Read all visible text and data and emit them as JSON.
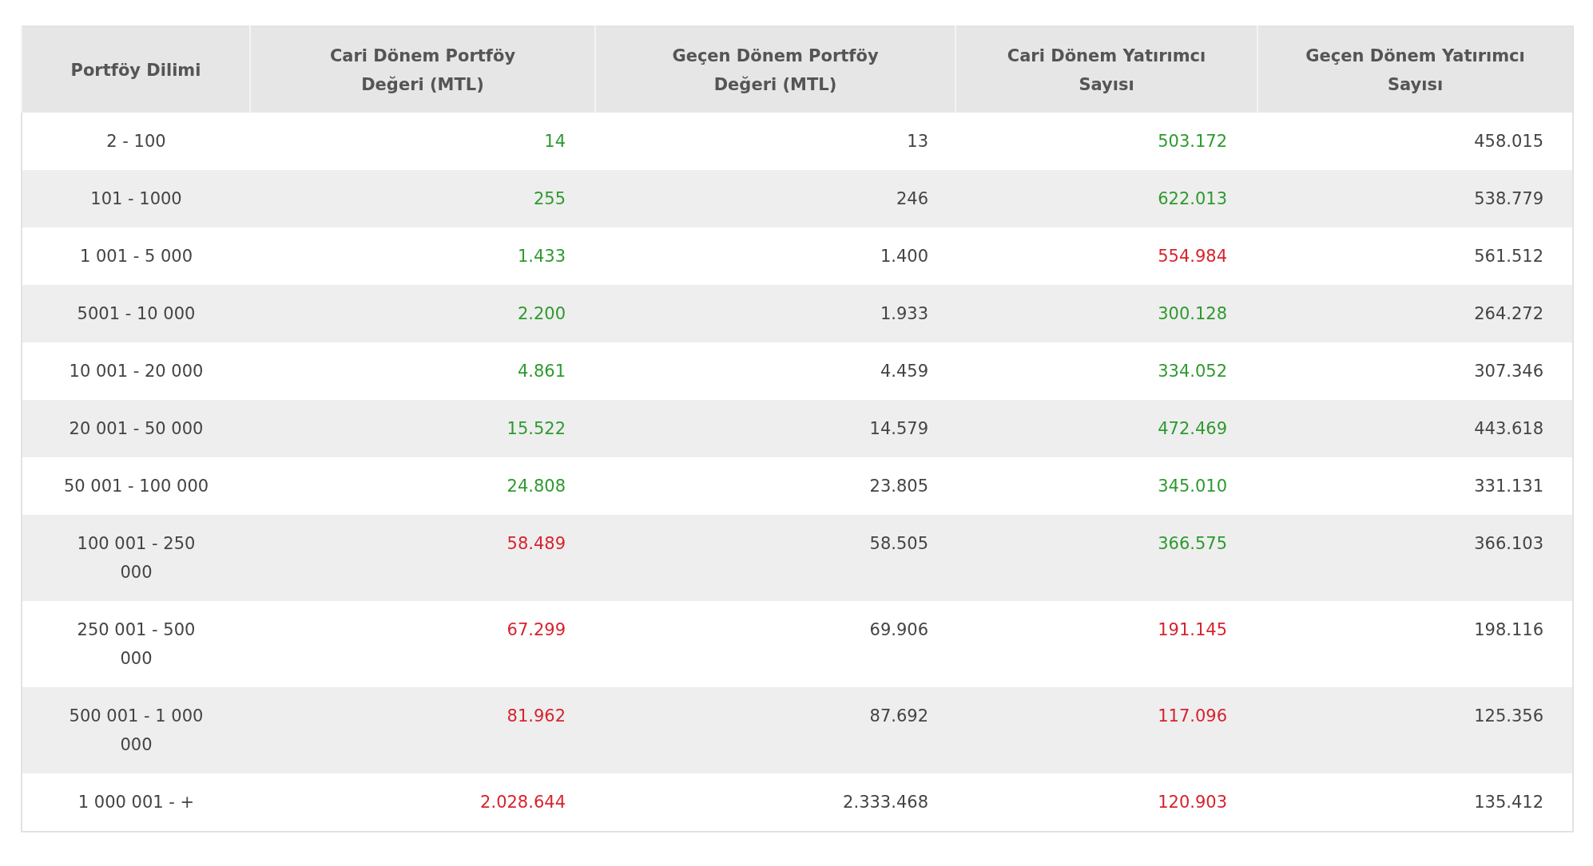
{
  "table": {
    "columns": [
      "Portföy Dilimi",
      "Cari Dönem Portföy Değeri (MTL)",
      "Geçen Dönem Portföy Değeri (MTL)",
      "Cari Dönem Yatırımcı Sayısı",
      "Geçen Dönem Yatırımcı Sayısı"
    ],
    "rows": [
      {
        "slice": "2 - 100",
        "current_value": {
          "text": "14",
          "color": "#2e9a2e"
        },
        "previous_value": "13",
        "current_investors": {
          "text": "503.172",
          "color": "#2e9a2e"
        },
        "previous_investors": "458.015"
      },
      {
        "slice": "101 - 1000",
        "current_value": {
          "text": "255",
          "color": "#2e9a2e"
        },
        "previous_value": "246",
        "current_investors": {
          "text": "622.013",
          "color": "#2e9a2e"
        },
        "previous_investors": "538.779"
      },
      {
        "slice": "1 001 - 5 000",
        "current_value": {
          "text": "1.433",
          "color": "#2e9a2e"
        },
        "previous_value": "1.400",
        "current_investors": {
          "text": "554.984",
          "color": "#d8232d"
        },
        "previous_investors": "561.512"
      },
      {
        "slice": "5001 - 10 000",
        "current_value": {
          "text": "2.200",
          "color": "#2e9a2e"
        },
        "previous_value": "1.933",
        "current_investors": {
          "text": "300.128",
          "color": "#2e9a2e"
        },
        "previous_investors": "264.272"
      },
      {
        "slice": "10 001 - 20 000",
        "current_value": {
          "text": "4.861",
          "color": "#2e9a2e"
        },
        "previous_value": "4.459",
        "current_investors": {
          "text": "334.052",
          "color": "#2e9a2e"
        },
        "previous_investors": "307.346"
      },
      {
        "slice": "20 001 - 50 000",
        "current_value": {
          "text": "15.522",
          "color": "#2e9a2e"
        },
        "previous_value": "14.579",
        "current_investors": {
          "text": "472.469",
          "color": "#2e9a2e"
        },
        "previous_investors": "443.618"
      },
      {
        "slice": "50 001 - 100 000",
        "current_value": {
          "text": "24.808",
          "color": "#2e9a2e"
        },
        "previous_value": "23.805",
        "current_investors": {
          "text": "345.010",
          "color": "#2e9a2e"
        },
        "previous_investors": "331.131"
      },
      {
        "slice": "100 001 - 250 000",
        "current_value": {
          "text": "58.489",
          "color": "#d8232d"
        },
        "previous_value": "58.505",
        "current_investors": {
          "text": "366.575",
          "color": "#2e9a2e"
        },
        "previous_investors": "366.103"
      },
      {
        "slice": "250 001 - 500 000",
        "current_value": {
          "text": "67.299",
          "color": "#d8232d"
        },
        "previous_value": "69.906",
        "current_investors": {
          "text": "191.145",
          "color": "#d8232d"
        },
        "previous_investors": "198.116"
      },
      {
        "slice": "500 001 - 1 000 000",
        "current_value": {
          "text": "81.962",
          "color": "#d8232d"
        },
        "previous_value": "87.692",
        "current_investors": {
          "text": "117.096",
          "color": "#d8232d"
        },
        "previous_investors": "125.356"
      },
      {
        "slice": "1 000 001 - +",
        "current_value": {
          "text": "2.028.644",
          "color": "#d8232d"
        },
        "previous_value": "2.333.468",
        "current_investors": {
          "text": "120.903",
          "color": "#d8232d"
        },
        "previous_investors": "135.412"
      }
    ]
  }
}
